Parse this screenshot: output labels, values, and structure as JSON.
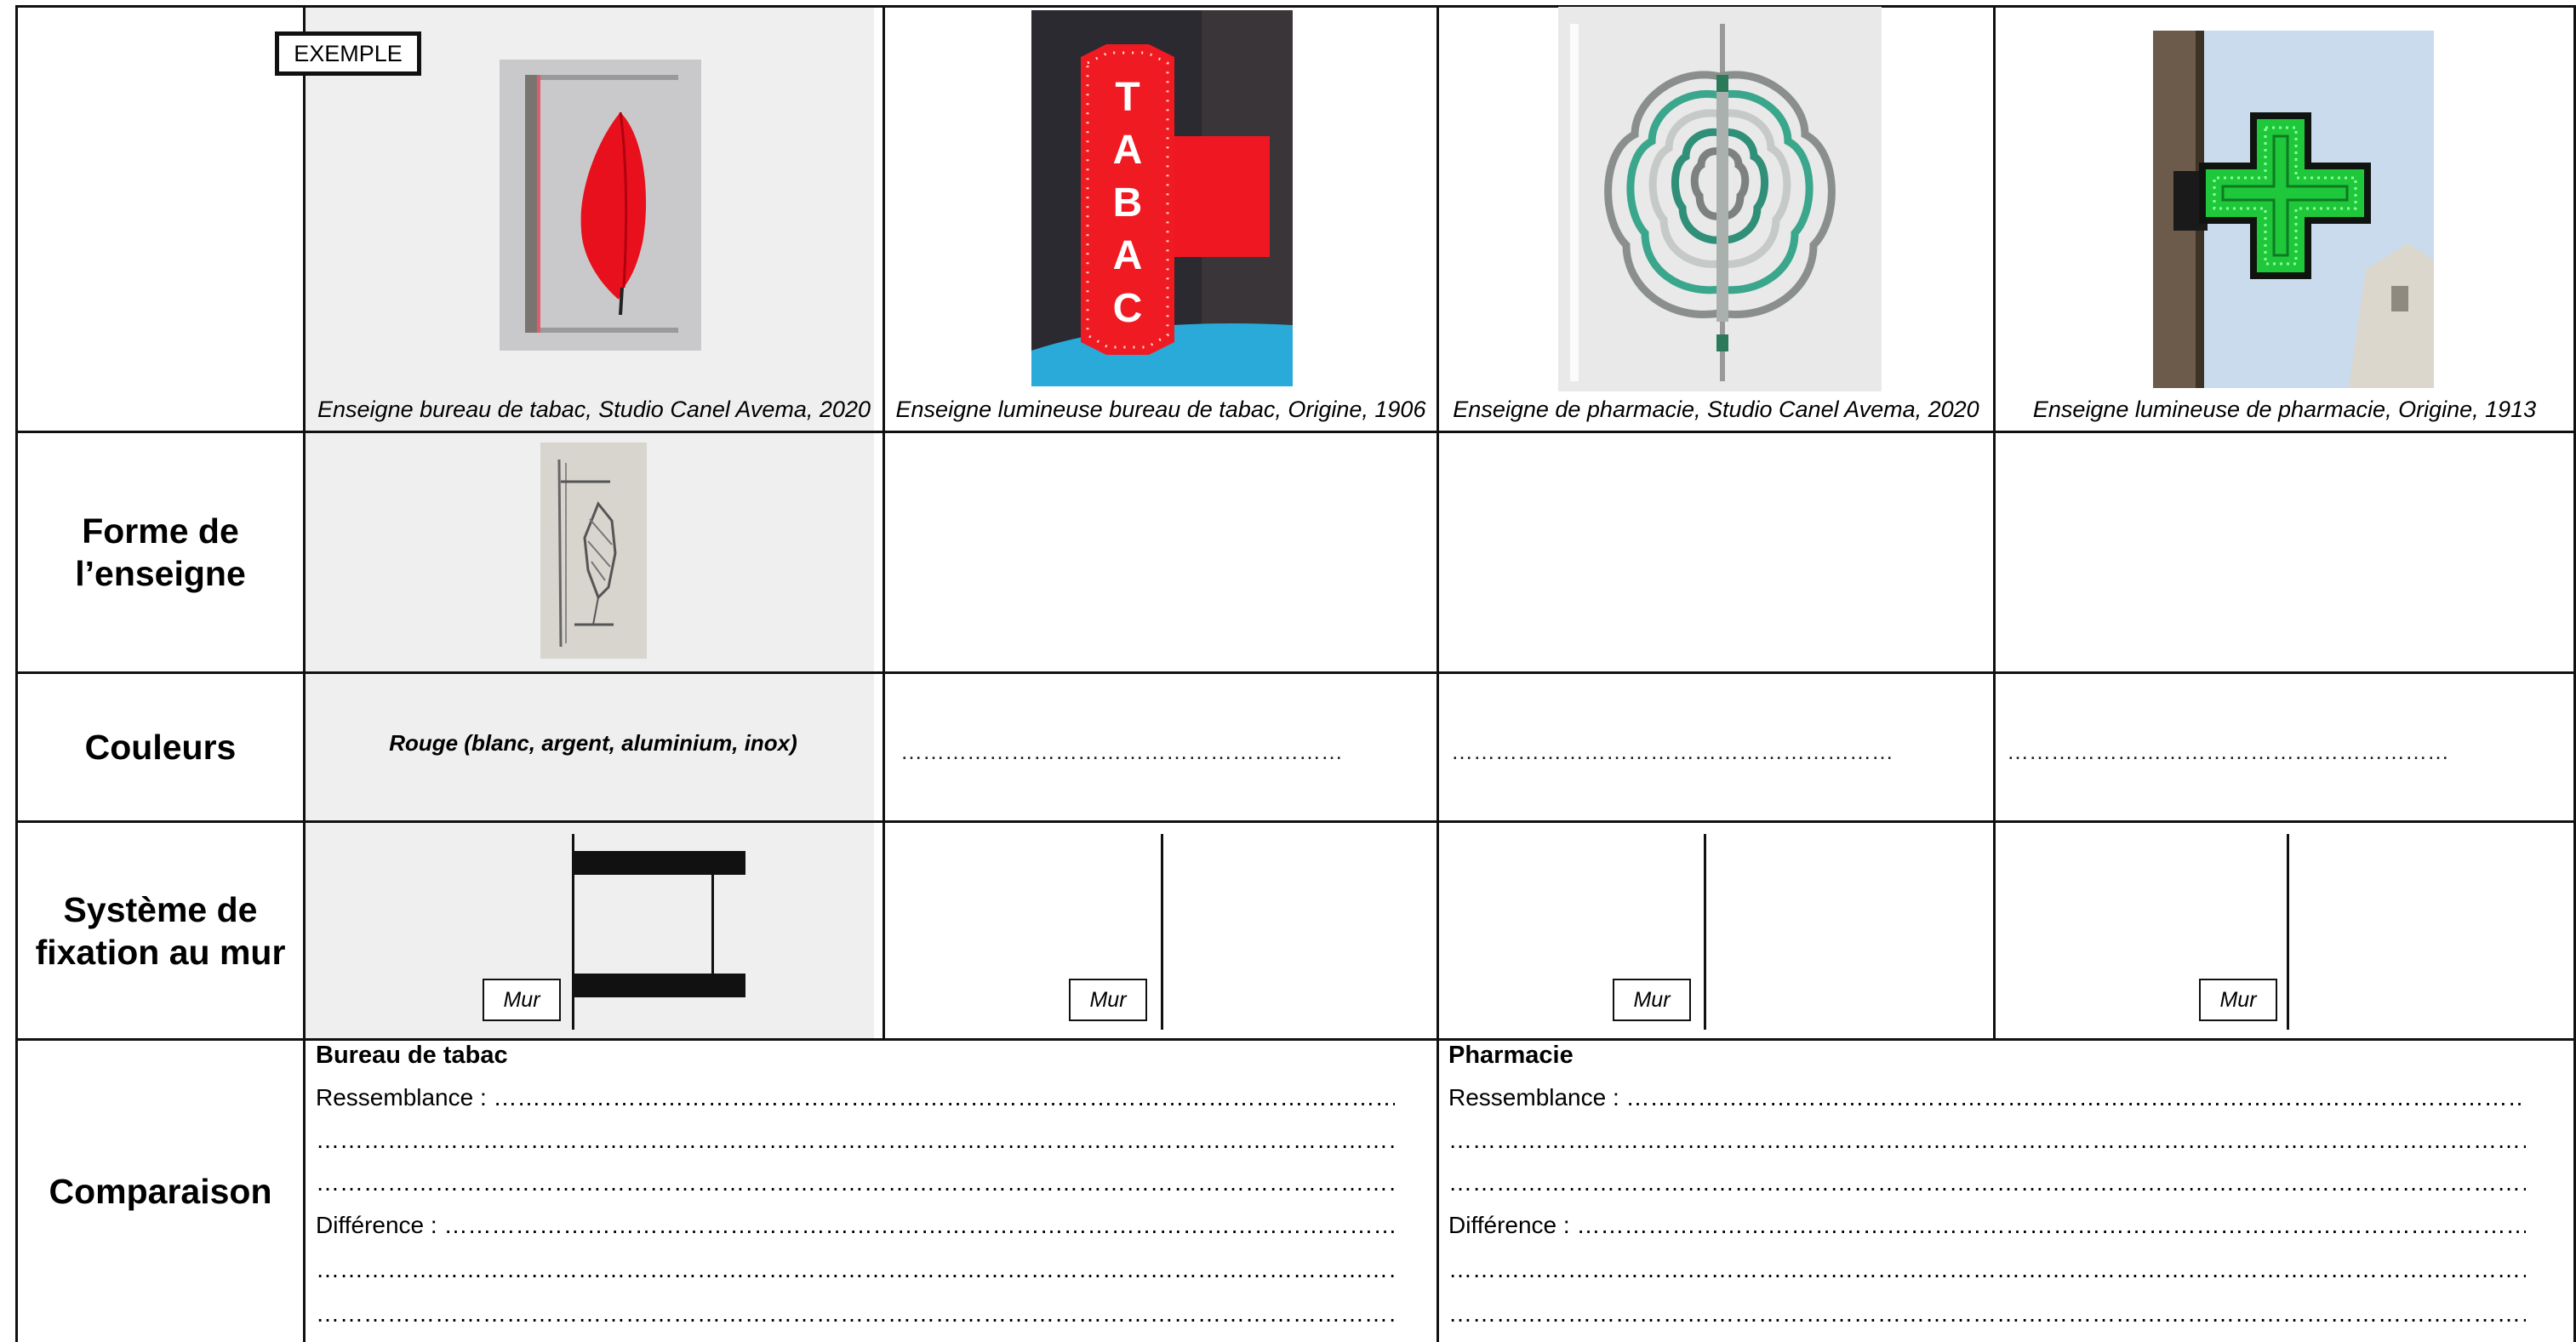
{
  "exemple_tag": "EXEMPLE",
  "row_headers": {
    "forme": "Forme de l’enseigne",
    "couleurs": "Couleurs",
    "fixation": "Système de fixation au mur",
    "comparaison": "Comparaison"
  },
  "captions": [
    "Enseigne bureau de tabac, Studio Canel Avema, 2020",
    "Enseigne lumineuse bureau de tabac, Origine, 1906",
    "Enseigne de pharmacie, Studio Canel Avema, 2020",
    "Enseigne lumineuse de pharmacie, Origine, 1913"
  ],
  "tabac_sign_letters": [
    "T",
    "A",
    "B",
    "A",
    "C"
  ],
  "couleurs_example": "Rouge (blanc, argent, aluminium, inox)",
  "dotted_fill": "……………………………………………………",
  "mur_label": "Mur",
  "comparison": {
    "tabac": {
      "title": "Bureau de tabac",
      "ressemblance": "Ressemblance : ………………………………………………………………………………………………………",
      "difference": "Différence : ……………………………………………………………………………………………………………",
      "blank": "……………………………………………………………………………………………………………………………"
    },
    "pharmacie": {
      "title": "Pharmacie",
      "ressemblance": "Ressemblance : ………………………………………………………………………………………………………………………………",
      "difference": "Différence : …………………………………………………………………………………………………………………………………",
      "blank": "………………………………………………………………………………………………………………………………………………"
    }
  },
  "colors": {
    "sign_red": "#e8101c",
    "cross_green": "#22c83a",
    "shade": "#efefef"
  }
}
